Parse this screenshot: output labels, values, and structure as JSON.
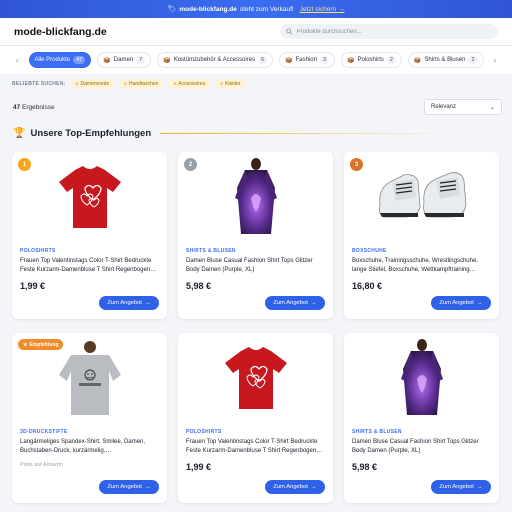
{
  "banner": {
    "icon": "tag-icon",
    "site": "mode-blickfang.de",
    "text": "steht zum Verkauf!",
    "link": "Jetzt sichern →"
  },
  "header": {
    "logo": "mode-blickfang.de",
    "search_placeholder": "Produkte durchsuchen..."
  },
  "categories": [
    {
      "label": "Alle Produkte",
      "count": "47",
      "active": true
    },
    {
      "label": "Damen",
      "count": "7",
      "icon": "box-icon"
    },
    {
      "label": "Kostümzubehör & Accessoires",
      "count": "6",
      "icon": "box-icon"
    },
    {
      "label": "Fashion",
      "count": "3",
      "icon": "box-icon"
    },
    {
      "label": "Poloshirts",
      "count": "2",
      "icon": "box-icon"
    },
    {
      "label": "Shirts & Blusen",
      "count": "2",
      "icon": "box-icon"
    }
  ],
  "popular": {
    "label": "BELIEBTE SUCHEN:",
    "tags": [
      "Damenmode",
      "Handtaschen",
      "Accessoires",
      "Kleider"
    ]
  },
  "results": {
    "count": "47",
    "label": "Ergebnisse",
    "sort": "Relevanz"
  },
  "section": {
    "title": "Unsere Top-Empfehlungen"
  },
  "products": [
    {
      "rank": "1",
      "category": "POLOSHIRTS",
      "title": "Frauen Top Valentinstags Color T-Shirt Bedruckte Feste Kurzarm-Damenbluse T Shirt Regenbogen…",
      "price": "1,99 €",
      "button": "Zum Angebot"
    },
    {
      "rank": "2",
      "category": "SHIRTS & BLUSEN",
      "title": "Damen Bluse Casual Fashion Shirt Tops Glitzer Body Damen (Purple, XL)",
      "price": "5,98 €",
      "button": "Zum Angebot"
    },
    {
      "rank": "3",
      "category": "BOXSCHUHE",
      "title": "Boxschuhe, Trainingsschuhe, Wrestlingschuhe, lange Stiefel, Boxschuhe, Wettkampftraining…",
      "price": "16,80 €",
      "button": "Zum Angebot"
    },
    {
      "badge": "Empfehlung",
      "category": "3D-DRUCKSTIFTE",
      "title": "Langärmeliges Spandex-Shirt, Smilee, Damen, Buchstaben-Druck, kurzärmelig,…",
      "price": "Preis auf Amazon",
      "button": "Zum Angebot"
    },
    {
      "category": "POLOSHIRTS",
      "title": "Frauen Top Valentinstags Color T-Shirt Bedruckte Feste Kurzarm-Damenbluse T Shirt Regenbogen…",
      "price": "1,99 €",
      "button": "Zum Angebot"
    },
    {
      "category": "SHIRTS & BLUSEN",
      "title": "Damen Bluse Casual Fashion Shirt Tops Glitzer Body Damen (Purple, XL)",
      "price": "5,98 €",
      "button": "Zum Angebot"
    }
  ],
  "colors": {
    "accent": "#3b6ef5",
    "banner": "#2f55d4",
    "gold": "#f2a71b"
  }
}
